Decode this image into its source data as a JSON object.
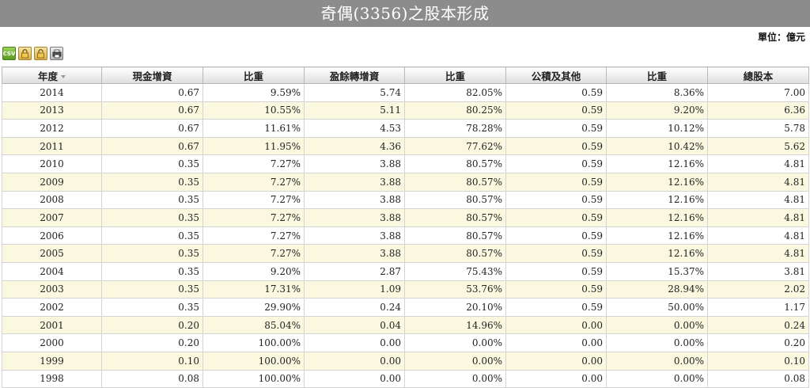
{
  "page": {
    "title": "奇偶(3356)之股本形成",
    "unit": "單位：億元"
  },
  "toolbar": {
    "csv_label": "CSV"
  },
  "table": {
    "columns": [
      "年度",
      "現金增資",
      "比重",
      "盈餘轉增資",
      "比重",
      "公積及其他",
      "比重",
      "總股本"
    ],
    "rows": [
      [
        "2014",
        "0.67",
        "9.59%",
        "5.74",
        "82.05%",
        "0.59",
        "8.36%",
        "7.00"
      ],
      [
        "2013",
        "0.67",
        "10.55%",
        "5.11",
        "80.25%",
        "0.59",
        "9.20%",
        "6.36"
      ],
      [
        "2012",
        "0.67",
        "11.61%",
        "4.53",
        "78.28%",
        "0.59",
        "10.12%",
        "5.78"
      ],
      [
        "2011",
        "0.67",
        "11.95%",
        "4.36",
        "77.62%",
        "0.59",
        "10.42%",
        "5.62"
      ],
      [
        "2010",
        "0.35",
        "7.27%",
        "3.88",
        "80.57%",
        "0.59",
        "12.16%",
        "4.81"
      ],
      [
        "2009",
        "0.35",
        "7.27%",
        "3.88",
        "80.57%",
        "0.59",
        "12.16%",
        "4.81"
      ],
      [
        "2008",
        "0.35",
        "7.27%",
        "3.88",
        "80.57%",
        "0.59",
        "12.16%",
        "4.81"
      ],
      [
        "2007",
        "0.35",
        "7.27%",
        "3.88",
        "80.57%",
        "0.59",
        "12.16%",
        "4.81"
      ],
      [
        "2006",
        "0.35",
        "7.27%",
        "3.88",
        "80.57%",
        "0.59",
        "12.16%",
        "4.81"
      ],
      [
        "2005",
        "0.35",
        "7.27%",
        "3.88",
        "80.57%",
        "0.59",
        "12.16%",
        "4.81"
      ],
      [
        "2004",
        "0.35",
        "9.20%",
        "2.87",
        "75.43%",
        "0.59",
        "15.37%",
        "3.81"
      ],
      [
        "2003",
        "0.35",
        "17.31%",
        "1.09",
        "53.76%",
        "0.59",
        "28.94%",
        "2.02"
      ],
      [
        "2002",
        "0.35",
        "29.90%",
        "0.24",
        "20.10%",
        "0.59",
        "50.00%",
        "1.17"
      ],
      [
        "2001",
        "0.20",
        "85.04%",
        "0.04",
        "14.96%",
        "0.00",
        "0.00%",
        "0.24"
      ],
      [
        "2000",
        "0.20",
        "100.00%",
        "0.00",
        "0.00%",
        "0.00",
        "0.00%",
        "0.20"
      ],
      [
        "1999",
        "0.10",
        "100.00%",
        "0.00",
        "0.00%",
        "0.00",
        "0.00%",
        "0.10"
      ],
      [
        "1998",
        "0.08",
        "100.00%",
        "0.00",
        "0.00%",
        "0.00",
        "0.00%",
        "0.08"
      ]
    ]
  }
}
